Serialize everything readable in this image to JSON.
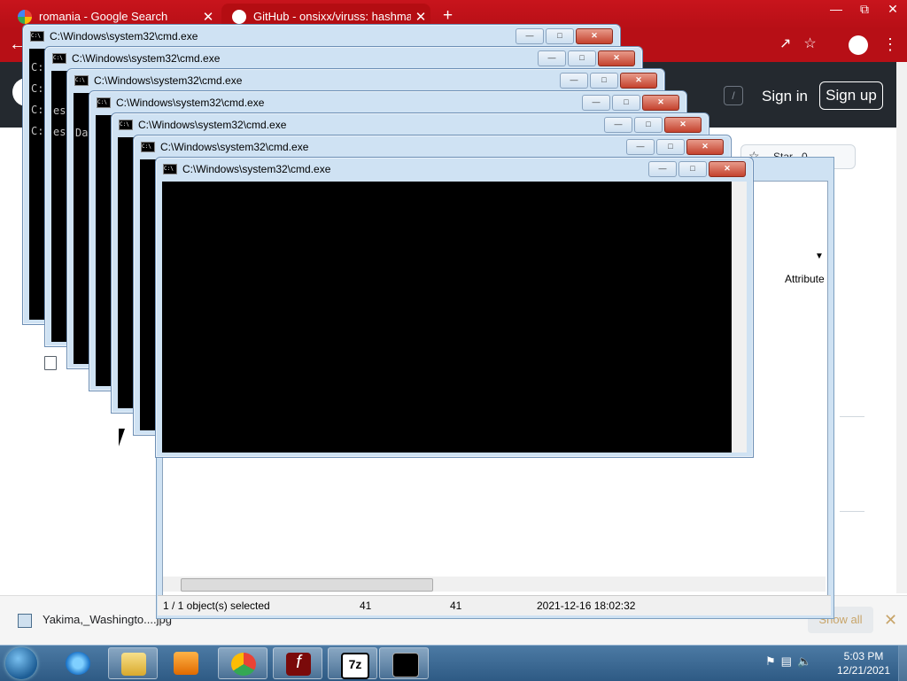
{
  "browser": {
    "tabs": [
      {
        "title": "romania - Google Search"
      },
      {
        "title": "GitHub - onsixx/viruss: hashmar"
      }
    ],
    "new_tab": "+",
    "close_glyph": "✕"
  },
  "github": {
    "slash_key": "/",
    "sign_in": "Sign in",
    "sign_up": "Sign up",
    "star_label": "Star",
    "star_count": "0"
  },
  "file_manager": {
    "column_attribute": "Attribute",
    "status": {
      "selection": "1 / 1 object(s) selected",
      "size": "41",
      "packed": "41",
      "modified": "2021-12-16 18:02:32"
    }
  },
  "cmd_windows": [
    {
      "title": "C:\\Windows\\system32\\cmd.exe"
    },
    {
      "title": "C:\\Windows\\system32\\cmd.exe"
    },
    {
      "title": "C:\\Windows\\system32\\cmd.exe"
    },
    {
      "title": "C:\\Windows\\system32\\cmd.exe"
    },
    {
      "title": "C:\\Windows\\system32\\cmd.exe"
    },
    {
      "title": "C:\\Windows\\system32\\cmd.exe"
    },
    {
      "title": "C:\\Windows\\system32\\cmd.exe"
    }
  ],
  "cmd_text": {
    "line1": "C:",
    "line2": "C:\\Us",
    "line3": "C:\\Us",
    "line4": "C:\\Us",
    "frag_a": "es",
    "frag_b": "es",
    "frag_c": "Dar"
  },
  "downloads": {
    "file_name": "Yakima,_Washingto....jpg",
    "show_all": "Show all"
  },
  "taskbar": {
    "apps": [
      "internet-explorer",
      "windows-explorer",
      "media-player",
      "chrome",
      "flash",
      "7zip",
      "cmd"
    ],
    "time": "5:03 PM",
    "date": "12/21/2021"
  },
  "colors": {
    "tab_bar": "#c8141c",
    "github_header": "#24292f",
    "cmd_frame": "#cfe2f3",
    "taskbar": "#2e5a84"
  }
}
